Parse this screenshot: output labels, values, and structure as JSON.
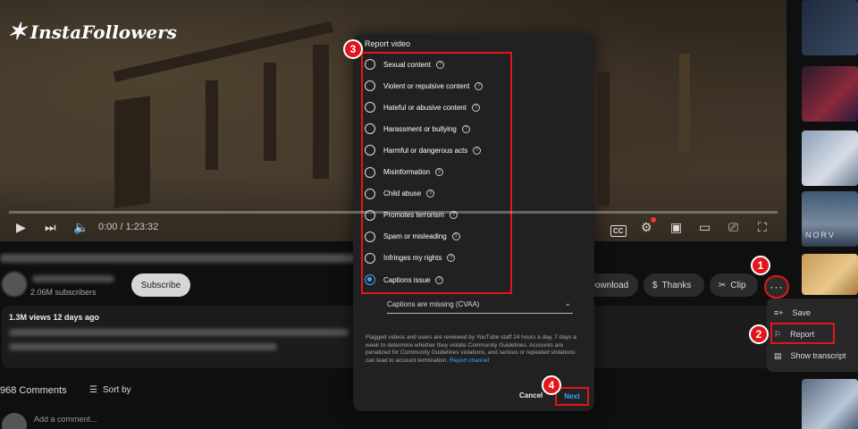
{
  "watermark": {
    "logo_text": "InstaFollowers"
  },
  "player": {
    "time": "0:00 / 1:23:32",
    "buttons": [
      "play-icon",
      "next-icon",
      "volume-icon",
      "cc-icon",
      "settings-icon",
      "miniplayer-icon",
      "theater-icon",
      "cast-icon",
      "fullscreen-icon"
    ],
    "cc_label": "CC"
  },
  "channel": {
    "subscribers": "2.06M subscribers",
    "subscribe_label": "Subscribe"
  },
  "actions": {
    "download": "Download",
    "thanks": "Thanks",
    "clip": "Clip",
    "more": "···"
  },
  "description": {
    "meta": "1.3M views  12 days ago"
  },
  "comments": {
    "count": "968 Comments",
    "sort_by": "Sort by",
    "add_placeholder": "Add a comment..."
  },
  "rail": {
    "thumb_label": "NORV"
  },
  "context_menu": {
    "items": [
      {
        "label": "Save",
        "icon": "playlist-add-icon"
      },
      {
        "label": "Report",
        "icon": "flag-icon"
      },
      {
        "label": "Show transcript",
        "icon": "transcript-icon"
      }
    ]
  },
  "dialog": {
    "title": "Report video",
    "options": [
      {
        "label": "Sexual content",
        "checked": false
      },
      {
        "label": "Violent or repulsive content",
        "checked": false
      },
      {
        "label": "Hateful or abusive content",
        "checked": false
      },
      {
        "label": "Harassment or bullying",
        "checked": false
      },
      {
        "label": "Harmful or dangerous acts",
        "checked": false
      },
      {
        "label": "Misinformation",
        "checked": false
      },
      {
        "label": "Child abuse",
        "checked": false
      },
      {
        "label": "Promotes terrorism",
        "checked": false
      },
      {
        "label": "Spam or misleading",
        "checked": false
      },
      {
        "label": "Infringes my rights",
        "checked": false
      },
      {
        "label": "Captions issue",
        "checked": true
      }
    ],
    "sub_reason": "Captions are missing (CVAA)",
    "disclaimer": "Flagged videos and users are reviewed by YouTube staff 24 hours a day, 7 days a week to determine whether they violate Community Guidelines. Accounts are penalized for Community Guidelines violations, and serious or repeated violations can lead to account termination.",
    "disclaimer_link": "Report channel",
    "cancel_label": "Cancel",
    "next_label": "Next"
  },
  "steps": [
    "1",
    "2",
    "3",
    "4"
  ],
  "colors": {
    "highlight": "#e0161c",
    "accent": "#3ea6ff",
    "dialog_bg": "#212121",
    "page_bg": "#0f0f0f"
  }
}
